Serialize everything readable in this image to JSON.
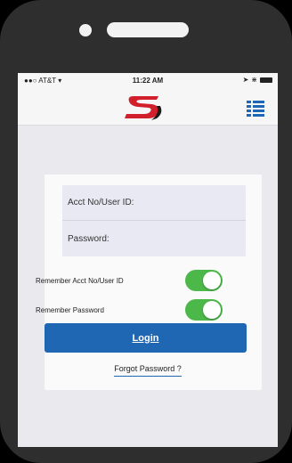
{
  "status_bar": {
    "carrier": "AT&T",
    "time": "11:22 AM"
  },
  "header": {
    "logo_icon": "s-logo",
    "menu_icon": "list-menu-icon"
  },
  "login_form": {
    "account_placeholder": "Acct No/User ID:",
    "password_placeholder": "Password:",
    "remember_account_label": "Remember Acct No/User ID",
    "remember_account_on": true,
    "remember_password_label": "Remember Password",
    "remember_password_on": true,
    "login_label": "Login",
    "forgot_label": "Forgot Password ?"
  },
  "colors": {
    "accent": "#1f66b3",
    "toggle_on": "#4cb849",
    "logo_red": "#d11f2c"
  }
}
